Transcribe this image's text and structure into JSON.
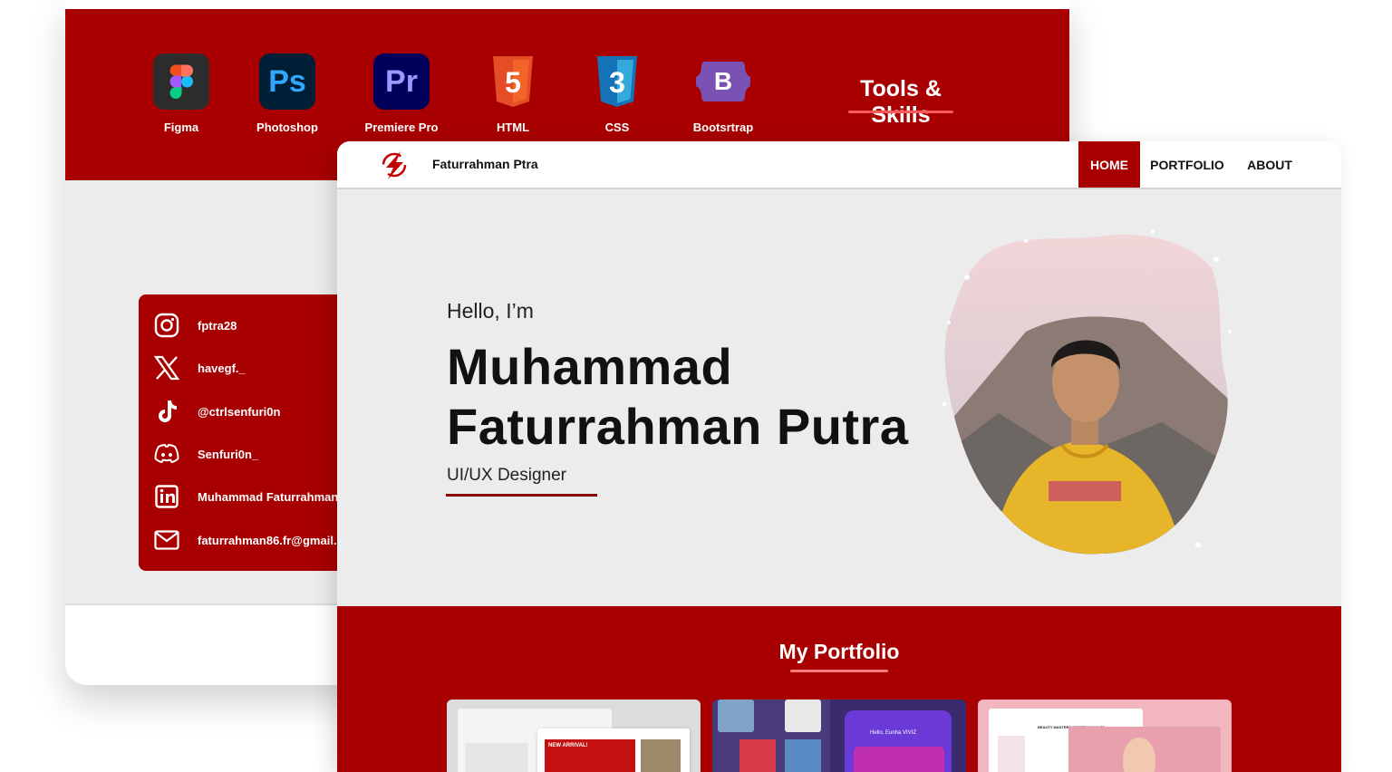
{
  "tools": {
    "title": "Tools & Skills",
    "items": [
      {
        "label": "Figma",
        "icon": "figma-icon",
        "bg": "#2c2c2c"
      },
      {
        "label": "Photoshop",
        "icon": "photoshop-icon",
        "glyph": "Ps",
        "bg": "#001e36",
        "fg": "#31a8ff"
      },
      {
        "label": "Premiere Pro",
        "icon": "premiere-pro-icon",
        "glyph": "Pr",
        "bg": "#00005b",
        "fg": "#9999ff"
      },
      {
        "label": "HTML",
        "icon": "html5-icon",
        "glyph": "5",
        "bg": "#e44d26"
      },
      {
        "label": "CSS",
        "icon": "css3-icon",
        "glyph": "3",
        "bg": "#1572b6"
      },
      {
        "label": "Bootsrtrap",
        "icon": "bootstrap-icon",
        "glyph": "B",
        "bg": "#7952b3"
      }
    ]
  },
  "social": {
    "items": [
      {
        "icon": "instagram-icon",
        "text": "fptra28"
      },
      {
        "icon": "x-twitter-icon",
        "text": "havegf._"
      },
      {
        "icon": "tiktok-icon",
        "text": "@ctrlsenfuri0n"
      },
      {
        "icon": "discord-icon",
        "text": "Senfuri0n_"
      },
      {
        "icon": "linkedin-icon",
        "text": "Muhammad Faturrahman"
      },
      {
        "icon": "mail-icon",
        "text": "faturrahman86.fr@gmail."
      }
    ]
  },
  "nav": {
    "brand": "Faturrahman Ptra",
    "items": [
      {
        "label": "HOME",
        "active": true
      },
      {
        "label": "PORTFOLIO",
        "active": false
      },
      {
        "label": "ABOUT",
        "active": false
      }
    ]
  },
  "hero": {
    "greeting": "Hello, I’m",
    "name_line1": "Muhammad",
    "name_line2": "Faturrahman Putra",
    "role": "UI/UX Designer"
  },
  "portfolio": {
    "title": "My Portfolio",
    "cards": [
      {
        "name": "sneaker-store-thumbnail",
        "banner": "NEW ARRIVAL!"
      },
      {
        "name": "mobile-app-thumbnail",
        "banner": "Hello, Eunha VIVIZ"
      },
      {
        "name": "beauty-site-thumbnail",
        "banner": "BEAUTY MASTERS EXPERT INSIGHTS"
      }
    ]
  },
  "colors": {
    "accent": "#a80000",
    "background": "#ececec"
  }
}
